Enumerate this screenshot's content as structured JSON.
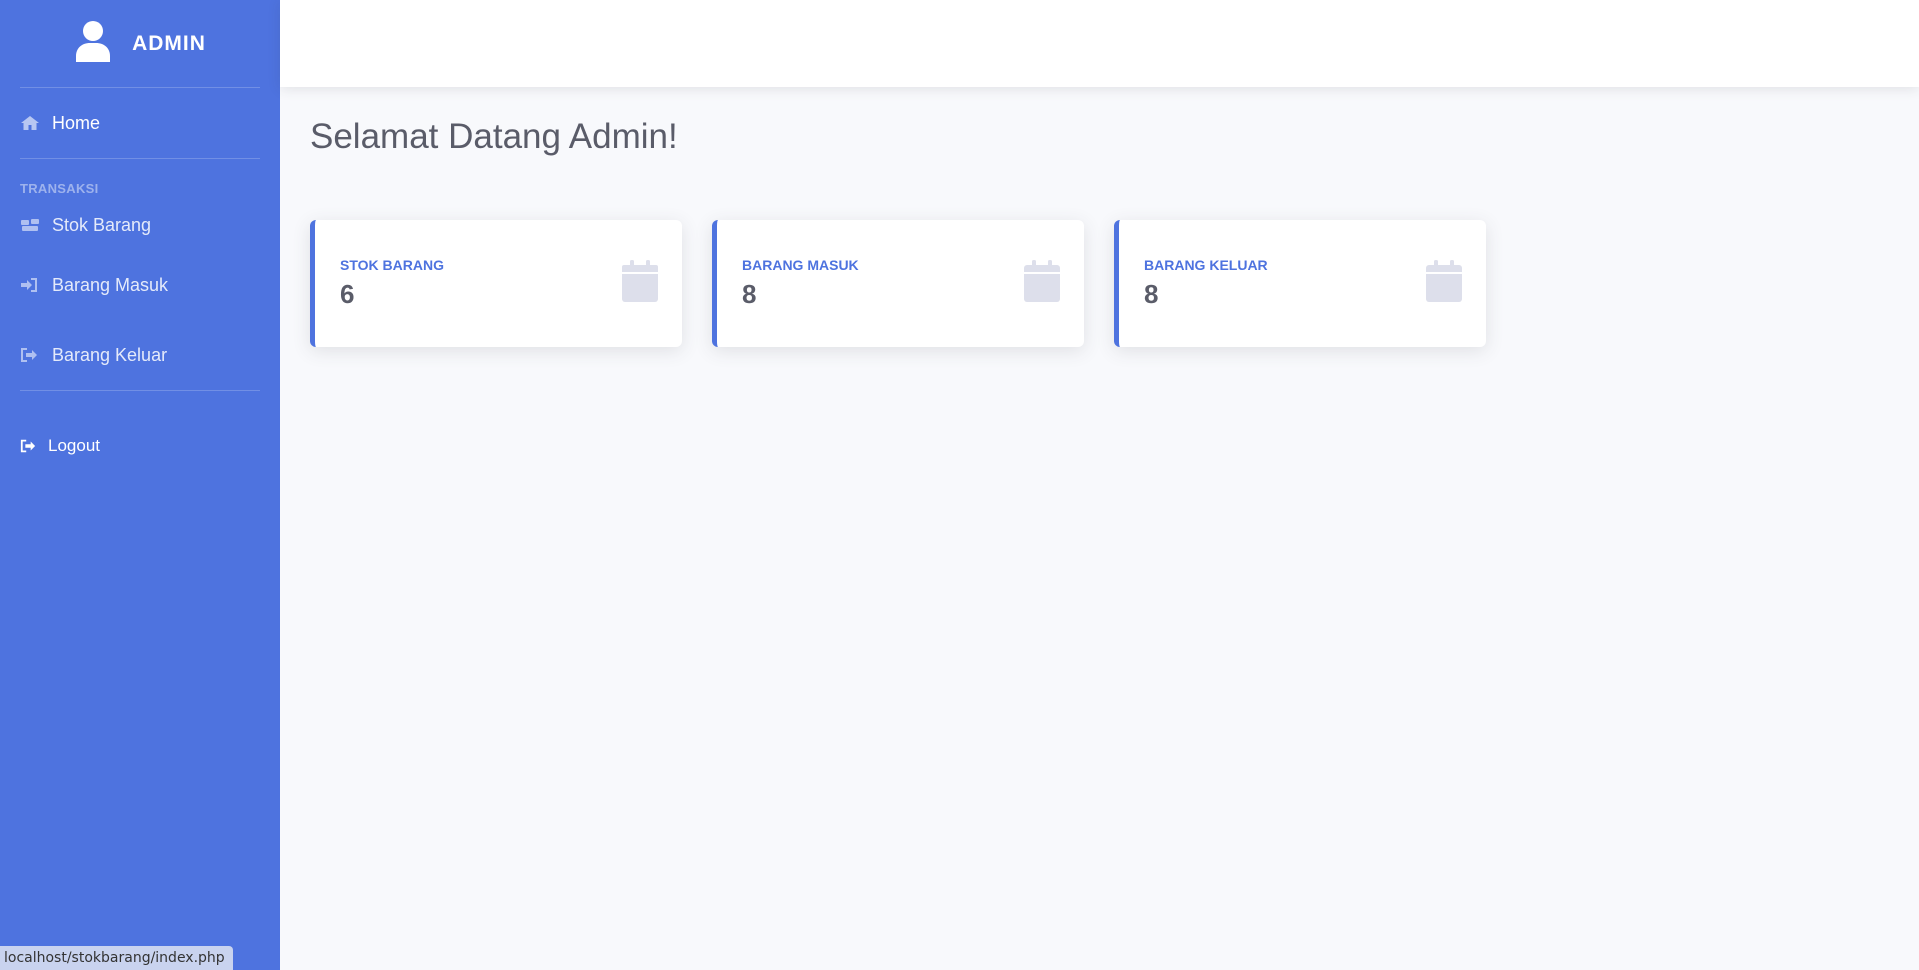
{
  "sidebar": {
    "brand": "ADMIN",
    "brand_icon": "user-icon",
    "home": {
      "label": "Home",
      "icon": "home-icon"
    },
    "heading": "TRANSAKSI",
    "items": [
      {
        "label": "Stok Barang",
        "icon": "boxes-icon"
      },
      {
        "label": "Barang Masuk",
        "icon": "sign-in-icon"
      },
      {
        "label": "Barang Keluar",
        "icon": "sign-out-icon"
      }
    ],
    "logout": {
      "label": "Logout",
      "icon": "logout-icon"
    }
  },
  "main": {
    "title": "Selamat Datang Admin!",
    "cards": [
      {
        "label": "STOK BARANG",
        "value": "6",
        "icon": "calendar-icon"
      },
      {
        "label": "BARANG MASUK",
        "value": "8",
        "icon": "calendar-icon"
      },
      {
        "label": "BARANG KELUAR",
        "value": "8",
        "icon": "calendar-icon"
      }
    ]
  },
  "status_bar": {
    "url": "localhost/stokbarang/index.php"
  },
  "colors": {
    "primary": "#4e73df",
    "background": "#f8f9fc",
    "text": "#5a5c69"
  }
}
